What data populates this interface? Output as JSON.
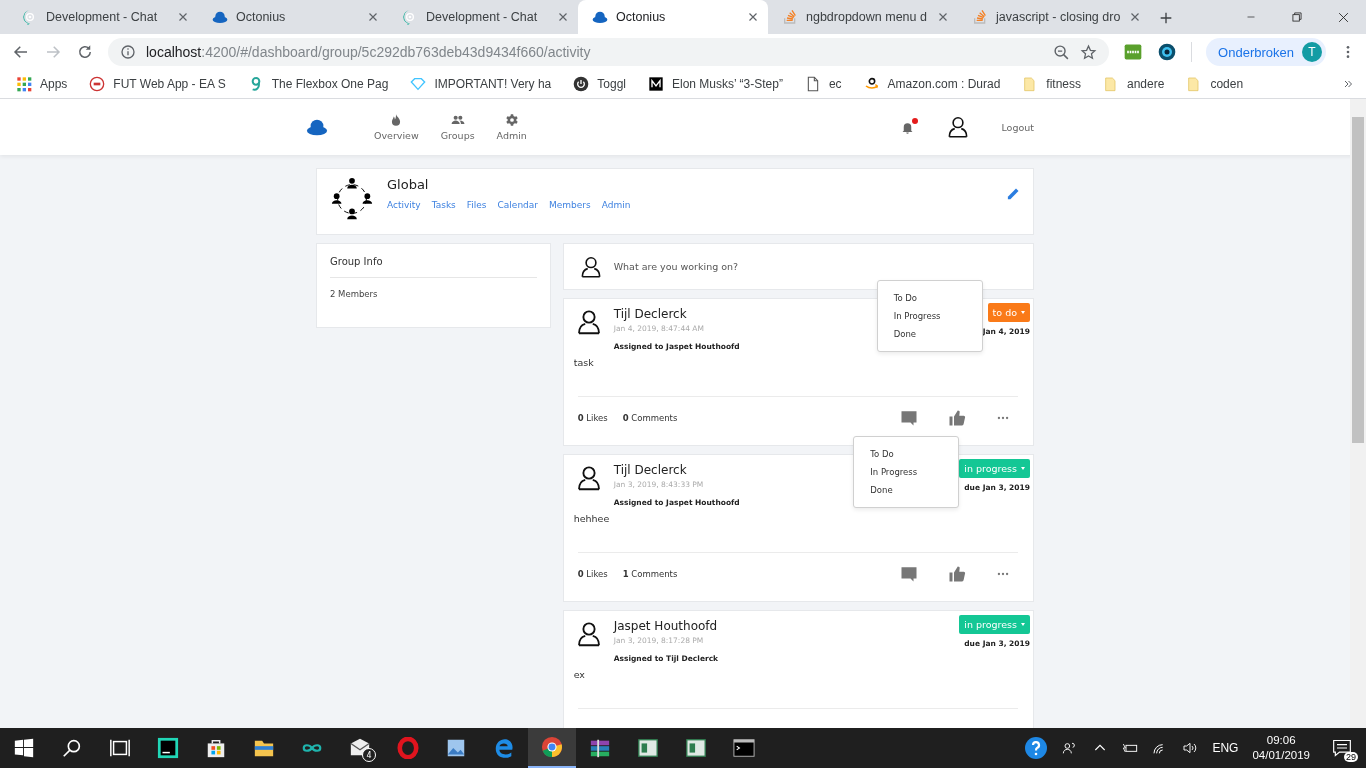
{
  "browser": {
    "tabs": [
      {
        "title": "Development - Chat",
        "kind": "chat",
        "selected": false
      },
      {
        "title": "Octonius",
        "kind": "cloud",
        "selected": false
      },
      {
        "title": "Development - Chat",
        "kind": "chat",
        "selected": false
      },
      {
        "title": "Octonius",
        "kind": "cloud",
        "selected": true
      },
      {
        "title": "ngbdropdown menu d",
        "kind": "stack",
        "selected": false
      },
      {
        "title": "javascript - closing dro",
        "kind": "stack",
        "selected": false
      }
    ],
    "address": {
      "host": "localhost",
      "path": ":4200/#/dashboard/group/5c292db763deb43d9434f660/activity"
    },
    "profile": {
      "label": "Onderbroken",
      "initial": "T"
    },
    "bookmarks": [
      {
        "label": "Apps",
        "kind": "apps"
      },
      {
        "label": "FUT Web App - EA S",
        "kind": "ea"
      },
      {
        "label": "The Flexbox One Pag",
        "kind": "g"
      },
      {
        "label": "IMPORTANT! Very ha",
        "kind": "diamond"
      },
      {
        "label": "Toggl",
        "kind": "toggl"
      },
      {
        "label": "Elon Musks’ “3-Step”",
        "kind": "medium"
      },
      {
        "label": "ec",
        "kind": "page"
      },
      {
        "label": "Amazon.com : Durad",
        "kind": "amazon"
      },
      {
        "label": "fitness",
        "kind": "folder"
      },
      {
        "label": "andere",
        "kind": "folder"
      },
      {
        "label": "coden",
        "kind": "folder"
      }
    ]
  },
  "app": {
    "nav": [
      {
        "label": "Overview",
        "kind": "flame"
      },
      {
        "label": "Groups",
        "kind": "people"
      },
      {
        "label": "Admin",
        "kind": "gear"
      }
    ],
    "notifications": {
      "unread": true
    },
    "logout": "Logout"
  },
  "group": {
    "name": "Global",
    "links": [
      "Activity",
      "Tasks",
      "Files",
      "Calendar",
      "Members",
      "Admin"
    ]
  },
  "group_info": {
    "title": "Group Info",
    "members": "2 Members"
  },
  "composer": {
    "placeholder": "What are you working on?"
  },
  "posts": [
    {
      "author": "Tijl Declerck",
      "time": "Jan 4, 2019, 8:47:44 AM",
      "assigned": "Assigned to Jaspet Houthoofd",
      "body": "task",
      "status": {
        "label": "to do",
        "kind": "todo"
      },
      "due": "Jan 4, 2019",
      "menu": [
        "To Do",
        "In Progress",
        "Done"
      ],
      "likes": "**0** Likes",
      "comments": "**0** Comments"
    },
    {
      "author": "Tijl Declerck",
      "time": "Jan 3, 2019, 8:43:33 PM",
      "assigned": "Assigned to Jaspet Houthoofd",
      "body": "hehhee",
      "status": {
        "label": "in progress",
        "kind": "in_progress"
      },
      "due": "due Jan 3, 2019",
      "menu": [
        "To Do",
        "In Progress",
        "Done"
      ],
      "likes": "**0** Likes",
      "comments": "**1** Comments"
    },
    {
      "author": "Jaspet Houthoofd",
      "time": "Jan 3, 2019, 8:17:28 PM",
      "assigned": "Assigned to Tijl Declerck",
      "body": "ex",
      "status": {
        "label": "in progress",
        "kind": "in_progress"
      },
      "due": "due Jan 3, 2019"
    }
  ],
  "taskbar": {
    "items": [
      {
        "kind": "windows",
        "selected": false
      },
      {
        "kind": "search",
        "selected": false
      },
      {
        "kind": "task-view",
        "selected": false
      },
      {
        "kind": "webstorm",
        "selected": false
      },
      {
        "kind": "store",
        "selected": false
      },
      {
        "kind": "explorer",
        "selected": false
      },
      {
        "kind": "infinity",
        "selected": false
      },
      {
        "kind": "mail",
        "selected": false,
        "badge": "4"
      },
      {
        "kind": "opera",
        "selected": false
      },
      {
        "kind": "photos",
        "selected": false
      },
      {
        "kind": "edge",
        "selected": false
      },
      {
        "kind": "chrome",
        "selected": true
      },
      {
        "kind": "archive",
        "selected": false
      },
      {
        "kind": "window",
        "selected": false
      },
      {
        "kind": "window",
        "selected": false
      },
      {
        "kind": "terminal",
        "selected": false
      }
    ],
    "tray": [
      {
        "kind": "help"
      },
      {
        "kind": "people"
      },
      {
        "kind": "caret"
      },
      {
        "kind": "battery"
      },
      {
        "kind": "wifi"
      },
      {
        "kind": "volume"
      }
    ],
    "lang": "ENG",
    "time": "09:06",
    "date": "04/01/2019",
    "notifications": "29"
  }
}
